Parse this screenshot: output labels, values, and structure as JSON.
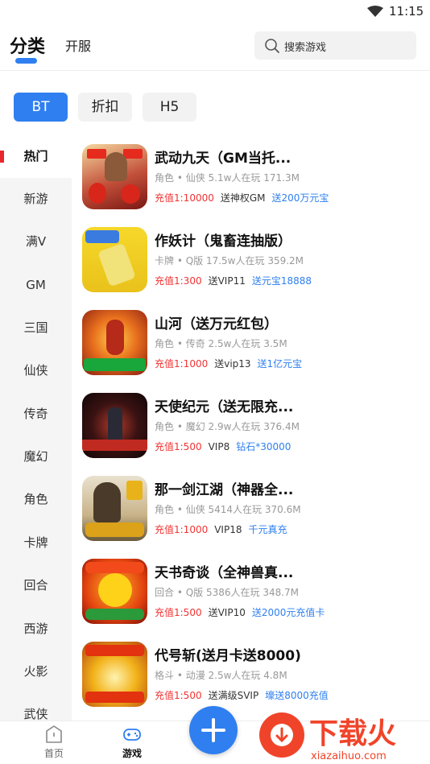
{
  "status_bar": {
    "time": "11:15"
  },
  "top_nav": {
    "tabs": [
      {
        "label": "分类",
        "active": true
      },
      {
        "label": "开服",
        "active": false
      }
    ],
    "search_placeholder": "搜索游戏"
  },
  "categories": [
    {
      "label": "BT",
      "active": true
    },
    {
      "label": "折扣",
      "active": false
    },
    {
      "label": "H5",
      "active": false
    }
  ],
  "sidebar": {
    "items": [
      {
        "label": "热门",
        "active": true
      },
      {
        "label": "新游"
      },
      {
        "label": "满V"
      },
      {
        "label": "GM"
      },
      {
        "label": "三国"
      },
      {
        "label": "仙侠"
      },
      {
        "label": "传奇"
      },
      {
        "label": "魔幻"
      },
      {
        "label": "角色"
      },
      {
        "label": "卡牌"
      },
      {
        "label": "回合"
      },
      {
        "label": "西游"
      },
      {
        "label": "火影"
      },
      {
        "label": "武侠"
      }
    ]
  },
  "games": [
    {
      "title": "武动九天（GM当托...",
      "meta": "角色 • 仙侠   5.1w人在玩   171.3M",
      "tag_red": "充值1:10000",
      "tag_black": "送神权GM",
      "tag_blue": "送200万元宝"
    },
    {
      "title": "作妖计（鬼畜连抽版）",
      "meta": "卡牌 • Q版   17.5w人在玩   359.2M",
      "tag_red": "充值1:300",
      "tag_black": "送VIP11",
      "tag_blue": "送元宝18888"
    },
    {
      "title": "山河（送万元红包）",
      "meta": "角色 • 传奇   2.5w人在玩   3.5M",
      "tag_red": "充值1:1000",
      "tag_black": "送vip13",
      "tag_blue": "送1亿元宝"
    },
    {
      "title": "天使纪元（送无限充...",
      "meta": "角色 • 魔幻   2.9w人在玩   376.4M",
      "tag_red": "充值1:500",
      "tag_black": "VIP8",
      "tag_blue": "钻石*30000"
    },
    {
      "title": "那一剑江湖（神器全...",
      "meta": "角色 • 仙侠   5414人在玩   370.6M",
      "tag_red": "充值1:1000",
      "tag_black": "VIP18",
      "tag_blue": "千元真充"
    },
    {
      "title": "天书奇谈（全神兽真...",
      "meta": "回合 • Q版   5386人在玩   348.7M",
      "tag_red": "充值1:500",
      "tag_black": "送VIP10",
      "tag_blue": "送2000元充值卡"
    },
    {
      "title": "代号斩(送月卡送8000)",
      "meta": "格斗 • 动漫   2.5w人在玩   4.8M",
      "tag_red": "充值1:500",
      "tag_black": "送满级SVIP",
      "tag_blue": "壕送8000充值"
    }
  ],
  "bottom_nav": {
    "home_label": "首页",
    "games_label": "游戏"
  },
  "watermark": {
    "text": "下载火",
    "url": "xiazaihuo.com"
  },
  "colors": {
    "accent": "#2f7ff0",
    "red": "#f23333",
    "sidebar_bg": "#f5f5f5"
  }
}
